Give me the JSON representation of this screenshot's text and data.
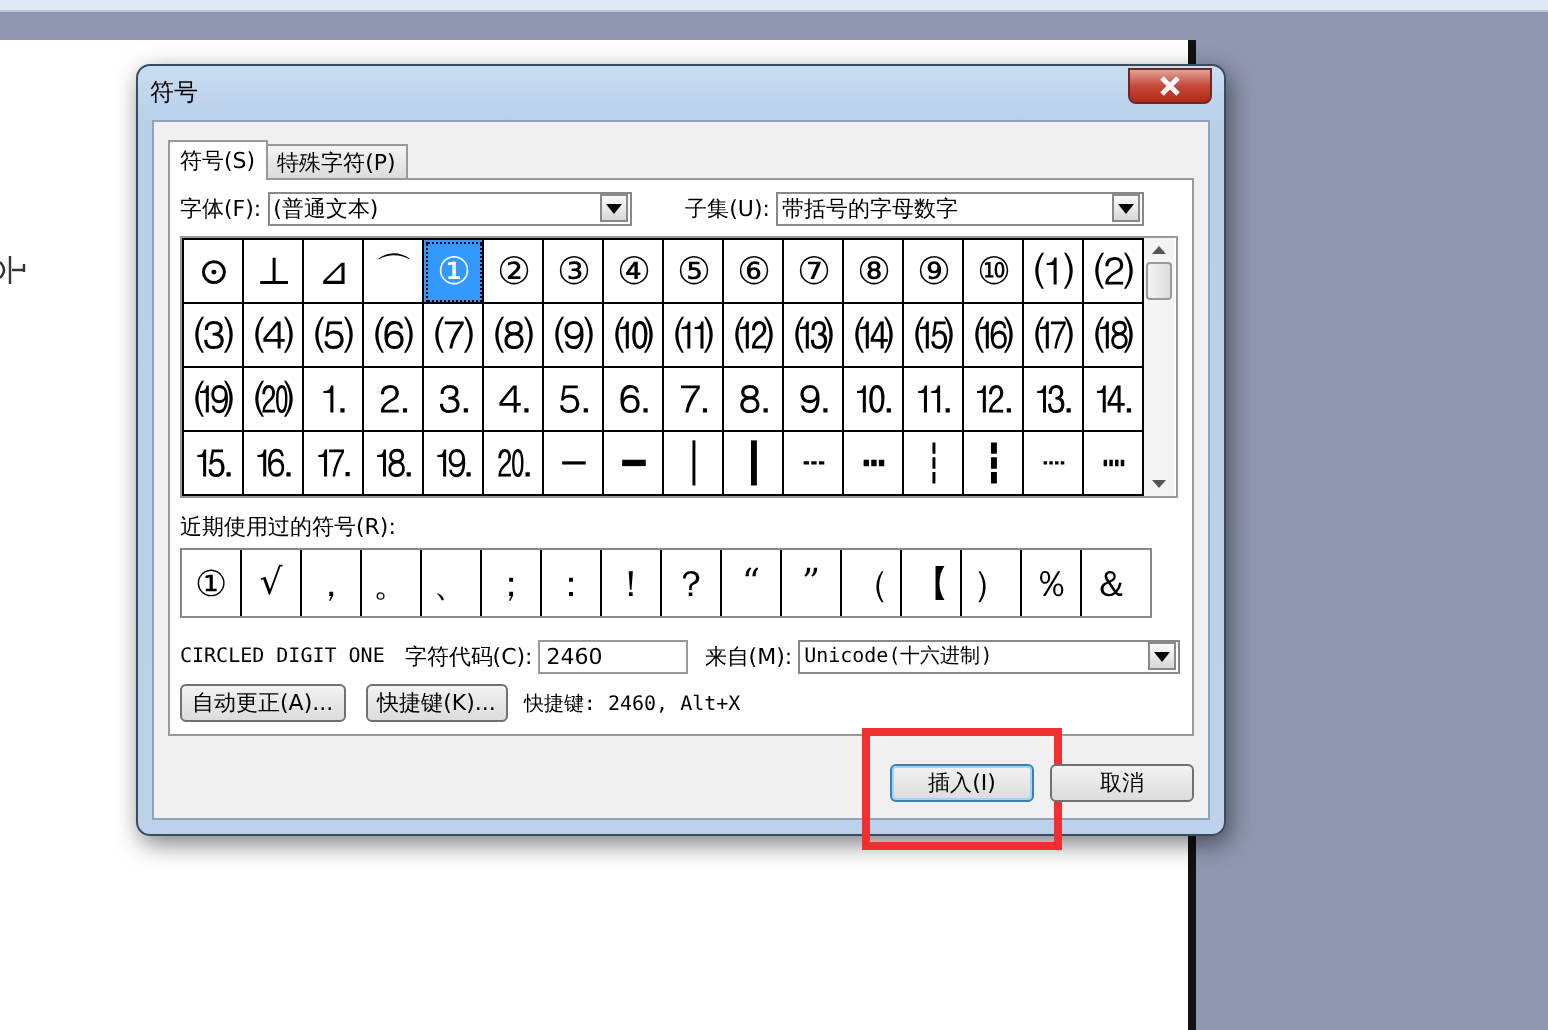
{
  "window": {
    "title": "符号"
  },
  "tabs": [
    {
      "label": "符号(S)",
      "selected": true
    },
    {
      "label": "特殊字符(P)",
      "selected": false
    }
  ],
  "font": {
    "label": "字体(F):",
    "value": "(普通文本)"
  },
  "subset": {
    "label": "子集(U):",
    "value": "带括号的字母数字"
  },
  "symbols": [
    {
      "char": "⊙",
      "selected": false
    },
    {
      "char": "⊥",
      "selected": false
    },
    {
      "char": "⊿",
      "selected": false
    },
    {
      "char": "⌒",
      "selected": false
    },
    {
      "char": "①",
      "selected": true
    },
    {
      "char": "②",
      "selected": false
    },
    {
      "char": "③",
      "selected": false
    },
    {
      "char": "④",
      "selected": false
    },
    {
      "char": "⑤",
      "selected": false
    },
    {
      "char": "⑥",
      "selected": false
    },
    {
      "char": "⑦",
      "selected": false
    },
    {
      "char": "⑧",
      "selected": false
    },
    {
      "char": "⑨",
      "selected": false
    },
    {
      "char": "⑩",
      "selected": false
    },
    {
      "char": "⑴",
      "selected": false
    },
    {
      "char": "⑵",
      "selected": false
    },
    {
      "char": "⑶",
      "selected": false
    },
    {
      "char": "⑷",
      "selected": false
    },
    {
      "char": "⑸",
      "selected": false
    },
    {
      "char": "⑹",
      "selected": false
    },
    {
      "char": "⑺",
      "selected": false
    },
    {
      "char": "⑻",
      "selected": false
    },
    {
      "char": "⑼",
      "selected": false
    },
    {
      "char": "⑽",
      "selected": false
    },
    {
      "char": "⑾",
      "selected": false
    },
    {
      "char": "⑿",
      "selected": false
    },
    {
      "char": "⒀",
      "selected": false
    },
    {
      "char": "⒁",
      "selected": false
    },
    {
      "char": "⒂",
      "selected": false
    },
    {
      "char": "⒃",
      "selected": false
    },
    {
      "char": "⒄",
      "selected": false
    },
    {
      "char": "⒅",
      "selected": false
    },
    {
      "char": "⒆",
      "selected": false
    },
    {
      "char": "⒇",
      "selected": false
    },
    {
      "char": "⒈",
      "selected": false
    },
    {
      "char": "⒉",
      "selected": false
    },
    {
      "char": "⒊",
      "selected": false
    },
    {
      "char": "⒋",
      "selected": false
    },
    {
      "char": "⒌",
      "selected": false
    },
    {
      "char": "⒍",
      "selected": false
    },
    {
      "char": "⒎",
      "selected": false
    },
    {
      "char": "⒏",
      "selected": false
    },
    {
      "char": "⒐",
      "selected": false
    },
    {
      "char": "⒑",
      "selected": false
    },
    {
      "char": "⒒",
      "selected": false
    },
    {
      "char": "⒓",
      "selected": false
    },
    {
      "char": "⒔",
      "selected": false
    },
    {
      "char": "⒕",
      "selected": false
    },
    {
      "char": "⒖",
      "selected": false
    },
    {
      "char": "⒗",
      "selected": false
    },
    {
      "char": "⒘",
      "selected": false
    },
    {
      "char": "⒙",
      "selected": false
    },
    {
      "char": "⒚",
      "selected": false
    },
    {
      "char": "⒛",
      "selected": false
    },
    {
      "char": "─",
      "selected": false
    },
    {
      "char": "━",
      "selected": false
    },
    {
      "char": "│",
      "selected": false
    },
    {
      "char": "┃",
      "selected": false
    },
    {
      "char": "┄",
      "selected": false
    },
    {
      "char": "┅",
      "selected": false
    },
    {
      "char": "┆",
      "selected": false
    },
    {
      "char": "┇",
      "selected": false
    },
    {
      "char": "┈",
      "selected": false
    },
    {
      "char": "┉",
      "selected": false
    }
  ],
  "recent": {
    "label": "近期使用过的符号(R):",
    "symbols": [
      "①",
      "√",
      "，",
      "。",
      "、",
      "；",
      "：",
      "！",
      "？",
      "“",
      "”",
      "（",
      "【",
      "）",
      "％",
      "＆"
    ]
  },
  "character_name": "CIRCLED DIGIT ONE",
  "char_code": {
    "label": "字符代码(C):",
    "value": "2460"
  },
  "from": {
    "label": "来自(M):",
    "value": "Unicode(十六进制)"
  },
  "buttons": [
    {
      "label": "自动更正(A)..."
    },
    {
      "label": "快捷键(K)..."
    }
  ],
  "shortcut_text": "快捷键: 2460, Alt+X",
  "footer_buttons": [
    {
      "label": "插入(I)",
      "highlighted": true
    },
    {
      "label": "取消",
      "highlighted": false
    }
  ]
}
